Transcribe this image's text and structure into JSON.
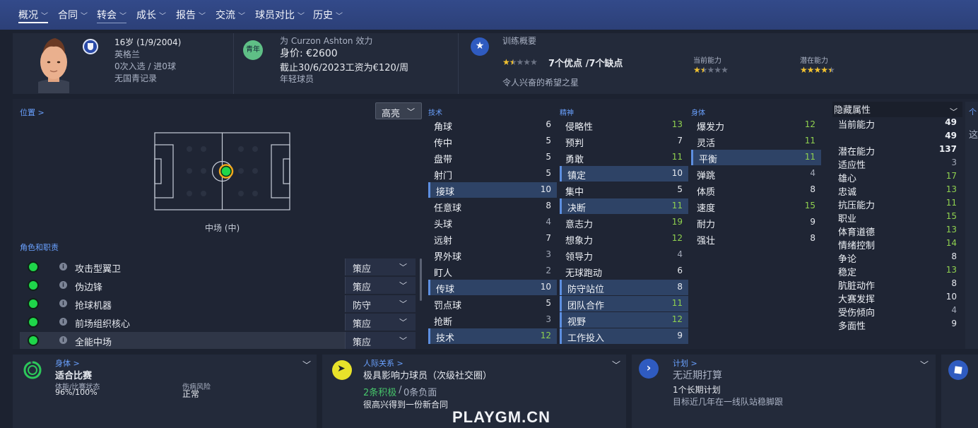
{
  "nav": [
    {
      "label": "概况",
      "active": true
    },
    {
      "label": "合同"
    },
    {
      "label": "转会",
      "underlined": true
    },
    {
      "label": "成长"
    },
    {
      "label": "报告"
    },
    {
      "label": "交流"
    },
    {
      "label": "球员对比"
    },
    {
      "label": "历史"
    }
  ],
  "profile": {
    "age_dob": "16岁 (1/9/2004)",
    "nation": "英格兰",
    "caps": "0次入选 / 进0球",
    "youth": "无国青记录"
  },
  "contract": {
    "badge": "青年",
    "club": "为 Curzon Ashton 效力",
    "value": "身价: €2600",
    "expiry": "截止30/6/2023工资为€120/周",
    "type": "年轻球员"
  },
  "training": {
    "title": "训练概要",
    "summary": "7个优点 /7个缺点",
    "summary_stars": 1.5,
    "note": "令人兴奋的希望之星",
    "current_label": "当前能力",
    "current_stars": 1.5,
    "potential_label": "潜在能力",
    "potential_stars": 4.5
  },
  "position": {
    "link": "位置 >",
    "highlight": "高亮",
    "label": "中场 (中)"
  },
  "roles": {
    "title": "角色和职责",
    "items": [
      {
        "name": "攻击型翼卫",
        "duty": "策应"
      },
      {
        "name": "伪边锋",
        "duty": "策应"
      },
      {
        "name": "抢球机器",
        "duty": "防守"
      },
      {
        "name": "前场组织核心",
        "duty": "策应"
      },
      {
        "name": "全能中场",
        "duty": "策应",
        "selected": true
      }
    ]
  },
  "technical": {
    "title": "技术",
    "items": [
      {
        "name": "角球",
        "value": "6"
      },
      {
        "name": "传中",
        "value": "5"
      },
      {
        "name": "盘带",
        "value": "5"
      },
      {
        "name": "射门",
        "value": "5"
      },
      {
        "name": "接球",
        "value": "10",
        "hl": true
      },
      {
        "name": "任意球",
        "value": "8"
      },
      {
        "name": "头球",
        "value": "4"
      },
      {
        "name": "远射",
        "value": "7"
      },
      {
        "name": "界外球",
        "value": "3"
      },
      {
        "name": "盯人",
        "value": "2"
      },
      {
        "name": "传球",
        "value": "10",
        "hl": true
      },
      {
        "name": "罚点球",
        "value": "5"
      },
      {
        "name": "抢断",
        "value": "3"
      },
      {
        "name": "技术",
        "value": "12",
        "hl": true
      }
    ]
  },
  "mental": {
    "title": "精神",
    "items": [
      {
        "name": "侵略性",
        "value": "13"
      },
      {
        "name": "预判",
        "value": "7"
      },
      {
        "name": "勇敢",
        "value": "11"
      },
      {
        "name": "镇定",
        "value": "10",
        "hl": true
      },
      {
        "name": "集中",
        "value": "5"
      },
      {
        "name": "决断",
        "value": "11",
        "hl": true
      },
      {
        "name": "意志力",
        "value": "19"
      },
      {
        "name": "想象力",
        "value": "12"
      },
      {
        "name": "领导力",
        "value": "4"
      },
      {
        "name": "无球跑动",
        "value": "6"
      },
      {
        "name": "防守站位",
        "value": "8",
        "hl": true
      },
      {
        "name": "团队合作",
        "value": "11",
        "hl": true
      },
      {
        "name": "视野",
        "value": "12",
        "hl": true
      },
      {
        "name": "工作投入",
        "value": "9",
        "hl": true
      }
    ]
  },
  "physical": {
    "title": "身体",
    "items": [
      {
        "name": "爆发力",
        "value": "12"
      },
      {
        "name": "灵活",
        "value": "11"
      },
      {
        "name": "平衡",
        "value": "11",
        "hl": true
      },
      {
        "name": "弹跳",
        "value": "4"
      },
      {
        "name": "体质",
        "value": "8"
      },
      {
        "name": "速度",
        "value": "15"
      },
      {
        "name": "耐力",
        "value": "9"
      },
      {
        "name": "强壮",
        "value": "8"
      }
    ]
  },
  "hidden": {
    "title": "隐藏属性",
    "items": [
      {
        "name": "当前能力",
        "value": "49"
      },
      {
        "name": "",
        "value": "49"
      },
      {
        "name": "潜在能力",
        "value": "137"
      },
      {
        "name": "适应性",
        "value": "3"
      },
      {
        "name": "雄心",
        "value": "17"
      },
      {
        "name": "忠诚",
        "value": "13"
      },
      {
        "name": "抗压能力",
        "value": "11"
      },
      {
        "name": "职业",
        "value": "15"
      },
      {
        "name": "体育道德",
        "value": "13"
      },
      {
        "name": "情绪控制",
        "value": "14"
      },
      {
        "name": "争论",
        "value": "8"
      },
      {
        "name": "稳定",
        "value": "13"
      },
      {
        "name": "肮脏动作",
        "value": "8"
      },
      {
        "name": "大赛发挥",
        "value": "10"
      },
      {
        "name": "受伤倾向",
        "value": "4"
      },
      {
        "name": "多面性",
        "value": "9"
      }
    ]
  },
  "right_edge": {
    "link": "个",
    "text": "这"
  },
  "cards": {
    "body": {
      "link": "身体 >",
      "status": "适合比赛",
      "fitness_label": "体能/比赛状态",
      "fitness_value": "96%/100%",
      "injury_label": "伤病风险",
      "injury_value": "正常"
    },
    "relations": {
      "link": "人际关系 >",
      "title": "极具影响力球员（次级社交圈）",
      "positive": "2条积极",
      "sep": " / ",
      "negative": "0条负面",
      "note": "很高兴得到一份新合同"
    },
    "plans": {
      "link": "计划 >",
      "title": "无近期打算",
      "plan": "1个长期计划",
      "note": "目标近几年在一线队站稳脚跟"
    }
  },
  "colors": {
    "accent": "#6aa1ff",
    "high": "#8fd14f",
    "role_dot": "#1fd64a"
  },
  "watermark": "PLAYGM.CN"
}
